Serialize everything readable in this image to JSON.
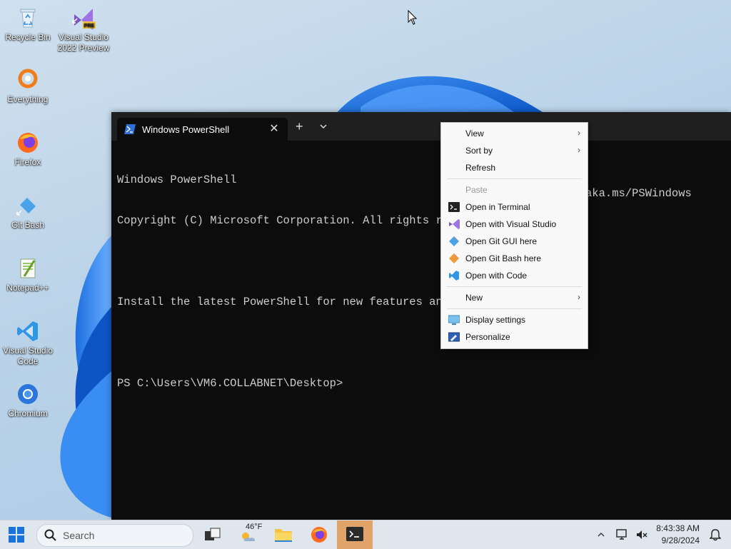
{
  "desktop": {
    "icons": [
      {
        "label": "Recycle Bin"
      },
      {
        "label": "Visual Studio 2022 Preview",
        "badge": "PRE"
      },
      {
        "label": "Everything"
      },
      {
        "label": "Firefox"
      },
      {
        "label": "Git Bash"
      },
      {
        "label": "Notepad++"
      },
      {
        "label": "Visual Studio Code"
      },
      {
        "label": "Chromium"
      }
    ]
  },
  "terminal": {
    "tab_title": "Windows PowerShell",
    "close_glyph": "✕",
    "new_tab_glyph": "+",
    "lines": [
      "Windows PowerShell",
      "Copyright (C) Microsoft Corporation. All rights res",
      "",
      "Install the latest PowerShell for new features and",
      "",
      "PS C:\\Users\\VM6.COLLABNET\\Desktop>"
    ],
    "tail_line_4": "aka.ms/PSWindows"
  },
  "context_menu": {
    "items": [
      {
        "label": "View",
        "submenu": true
      },
      {
        "label": "Sort by",
        "submenu": true
      },
      {
        "label": "Refresh"
      },
      {
        "label": "Paste",
        "disabled": true
      },
      {
        "label": "Open in Terminal",
        "icon": "terminal-icon"
      },
      {
        "label": "Open with Visual Studio",
        "icon": "visual-studio-icon"
      },
      {
        "label": "Open Git GUI here",
        "icon": "git-gui-icon"
      },
      {
        "label": "Open Git Bash here",
        "icon": "git-bash-icon"
      },
      {
        "label": "Open with Code",
        "icon": "vscode-icon"
      },
      {
        "label": "New",
        "submenu": true
      },
      {
        "label": "Display settings",
        "icon": "display-icon"
      },
      {
        "label": "Personalize",
        "icon": "personalize-icon"
      }
    ],
    "submenu_arrow": "›"
  },
  "taskbar": {
    "search_placeholder": "Search",
    "weather_temp": "46°F",
    "time": "8:43:38 AM",
    "date": "9/28/2024"
  },
  "colors": {
    "accent": "#0a64c8",
    "terminal_bg": "#0c0c0c",
    "terminal_text": "#cccccc"
  }
}
